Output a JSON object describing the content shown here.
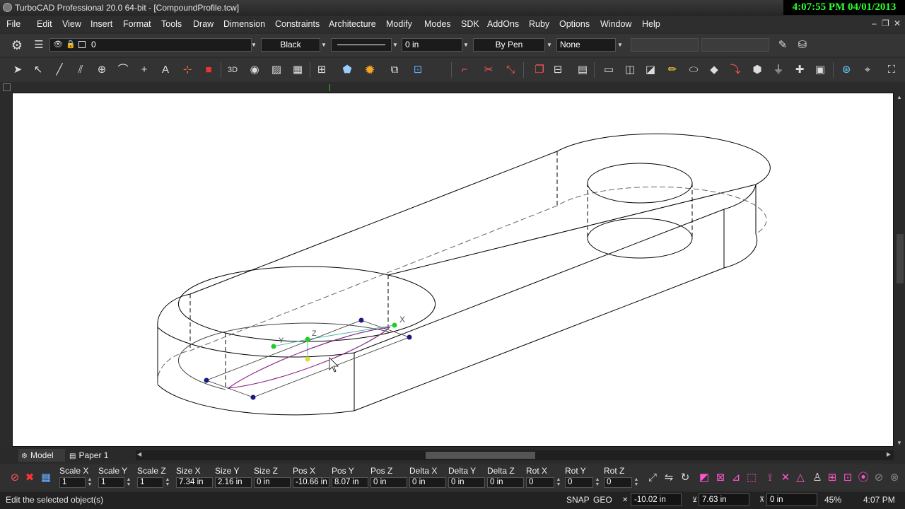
{
  "titlebar": {
    "title": "TurboCAD Professional 20.0 64-bit - [CompoundProfile.tcw]",
    "clock": "4:07:55 PM 04/01/2013"
  },
  "menu": [
    "File",
    "Edit",
    "View",
    "Insert",
    "Format",
    "Tools",
    "Draw",
    "Dimension",
    "Constraints",
    "Architecture",
    "Modify",
    "Modes",
    "SDK",
    "AddOns",
    "Ruby",
    "Options",
    "Window",
    "Help"
  ],
  "window_controls": {
    "minimize": "–",
    "restore": "❐",
    "close": "✕"
  },
  "property_toolbar": {
    "layer": "0",
    "color": "Black",
    "line_width": "0 in",
    "pen": "By Pen",
    "fill": "None"
  },
  "tabs": {
    "model": "Model",
    "paper": "Paper 1"
  },
  "inspector": {
    "labels": [
      "Scale X",
      "Scale Y",
      "Scale Z",
      "Size X",
      "Size Y",
      "Size Z",
      "Pos X",
      "Pos Y",
      "Pos Z",
      "Delta X",
      "Delta Y",
      "Delta Z",
      "Rot X",
      "Rot Y",
      "Rot Z"
    ],
    "values": [
      "1",
      "1",
      "1",
      "7.34 in",
      "2.16 in",
      "0 in",
      "-10.66 in",
      "8.07 in",
      "0 in",
      "0 in",
      "0 in",
      "0 in",
      "0",
      "0",
      "0"
    ]
  },
  "statusbar": {
    "message": "Edit the selected object(s)",
    "snap": "SNAP",
    "geo": "GEO",
    "x": "-10.02 in",
    "y": "7.63 in",
    "z": "0 in",
    "zoom": "45%",
    "time": "4:07 PM"
  },
  "canvas_labels": {
    "axis_x": "X",
    "axis_y": "Y",
    "axis_z": "Z"
  },
  "icons": [
    "settings-icon",
    "layer-visibility-icon",
    "select-arrow-icon",
    "line-icon",
    "circle-icon",
    "arc-icon",
    "text-icon",
    "3d-icon",
    "hatch-icon",
    "snap-icon",
    "extrude-icon",
    "render-icon"
  ]
}
